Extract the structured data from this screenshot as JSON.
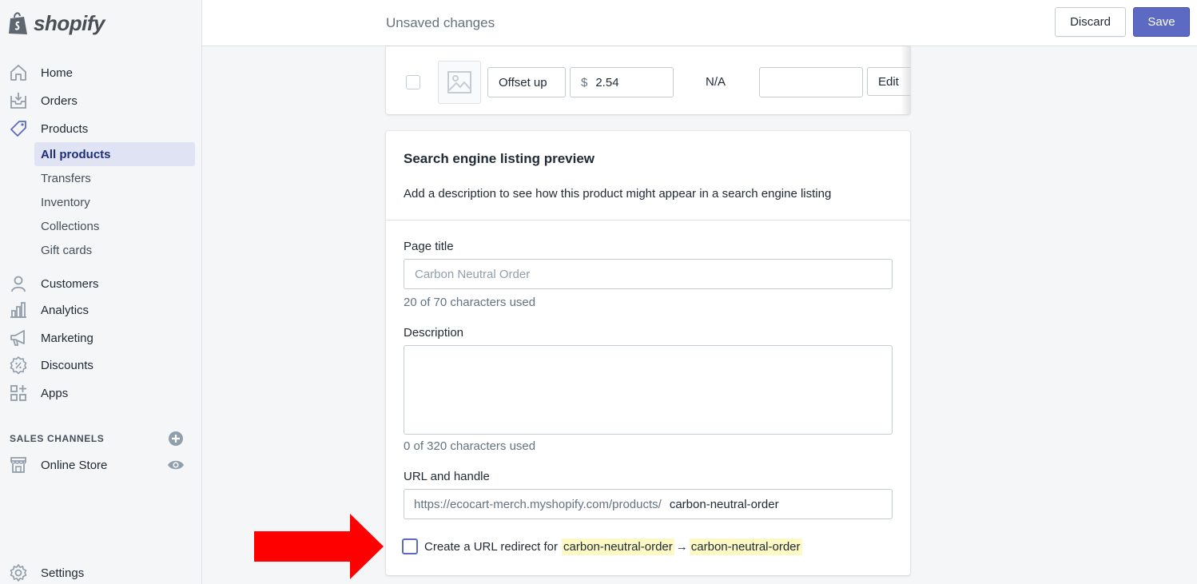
{
  "brand": {
    "name": "shopify"
  },
  "nav": {
    "items": [
      {
        "label": "Home",
        "icon": "home-icon"
      },
      {
        "label": "Orders",
        "icon": "orders-icon"
      },
      {
        "label": "Products",
        "icon": "tag-icon"
      },
      {
        "label": "Customers",
        "icon": "person-icon"
      },
      {
        "label": "Analytics",
        "icon": "bar-chart-icon"
      },
      {
        "label": "Marketing",
        "icon": "megaphone-icon"
      },
      {
        "label": "Discounts",
        "icon": "discount-icon"
      },
      {
        "label": "Apps",
        "icon": "apps-icon"
      }
    ],
    "product_subitems": [
      {
        "label": "All products",
        "selected": true
      },
      {
        "label": "Transfers"
      },
      {
        "label": "Inventory"
      },
      {
        "label": "Collections"
      },
      {
        "label": "Gift cards"
      }
    ],
    "sales_channels_heading": "SALES CHANNELS",
    "online_store": "Online Store",
    "settings": "Settings"
  },
  "topbar": {
    "title": "Unsaved changes",
    "discard_label": "Discard",
    "save_label": "Save"
  },
  "variant_row": {
    "option_value": "Offset up",
    "currency_symbol": "$",
    "price": "2.54",
    "quantity": "N/A",
    "sku_value": "",
    "edit_label": "Edit"
  },
  "seo": {
    "title": "Search engine listing preview",
    "subtitle": "Add a description to see how this product might appear in a search engine listing",
    "page_title_label": "Page title",
    "page_title_placeholder": "Carbon Neutral Order",
    "page_title_help": "20 of 70 characters used",
    "description_label": "Description",
    "description_value": "",
    "description_help": "0 of 320 characters used",
    "url_label": "URL and handle",
    "url_prefix": "https://ecocart-merch.myshopify.com/products/",
    "url_handle": "carbon-neutral-order",
    "redirect_text": "Create a URL redirect for",
    "redirect_from": "carbon-neutral-order",
    "redirect_arrow": "→",
    "redirect_to": "carbon-neutral-order",
    "redirect_checked": false
  },
  "colors": {
    "accent": "#5c6ac4",
    "annotation_arrow": "#ff0000",
    "highlight": "#fcf9c4"
  }
}
